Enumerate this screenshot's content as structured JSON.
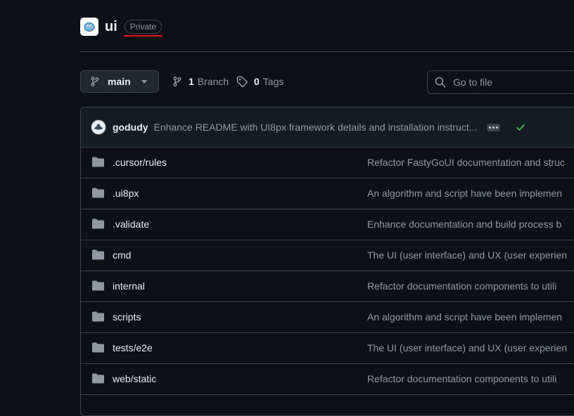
{
  "repo": {
    "name": "ui",
    "visibility": "Private"
  },
  "toolbar": {
    "branch": "main",
    "branches_count": "1",
    "branches_label": "Branch",
    "tags_count": "0",
    "tags_label": "Tags",
    "search_placeholder": "Go to file"
  },
  "latest_commit": {
    "author": "godudy",
    "message": "Enhance README with UI8px framework details and installation instruct..."
  },
  "files": [
    {
      "name": ".cursor/rules",
      "commit": "Refactor FastyGoUI documentation and struc"
    },
    {
      "name": ".ui8px",
      "commit": "An algorithm and script have been implemen"
    },
    {
      "name": ".validate",
      "commit": "Enhance documentation and build process b"
    },
    {
      "name": "cmd",
      "commit": "The UI (user interface) and UX (user experien"
    },
    {
      "name": "internal",
      "commit": "Refactor documentation components to utili"
    },
    {
      "name": "scripts",
      "commit": "An algorithm and script have been implemen"
    },
    {
      "name": "tests/e2e",
      "commit": "The UI (user interface) and UX (user experien"
    },
    {
      "name": "web/static",
      "commit": "Refactor documentation components to utili"
    }
  ],
  "colors": {
    "background": "#0d1117",
    "border": "#3d444d",
    "muted_text": "#9198a1",
    "folder_icon": "#9198a1",
    "success": "#3fb950",
    "highlight_underline": "#e5161d"
  },
  "icons": {
    "repo_avatar": "gopher-logo-icon",
    "branch": "git-branch-icon",
    "tag": "tag-icon",
    "search": "search-icon",
    "folder": "folder-icon",
    "status": "check-icon",
    "more": "kebab-horizontal-icon"
  }
}
